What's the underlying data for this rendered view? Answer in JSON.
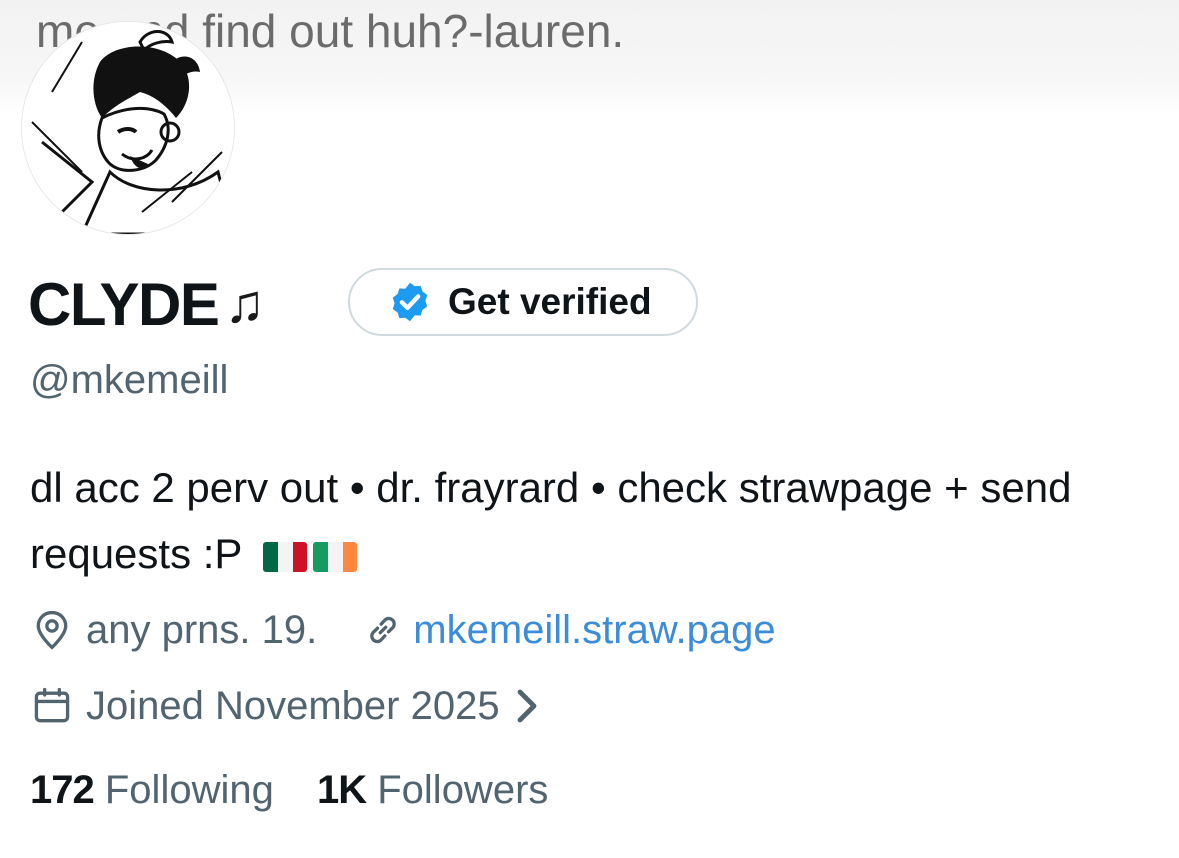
{
  "banner": {
    "text": "me and find out huh?-lauren."
  },
  "profile": {
    "display_name": "CLYDE",
    "name_emoji": "♫",
    "verify_button_label": "Get verified",
    "handle": "@mkemeill",
    "bio": "dl acc 2 perv out • dr. frayrard • check strawpage + send requests :P",
    "location": "any prns. 19.",
    "website": "mkemeill.straw.page",
    "joined": "Joined November 2025",
    "following_count": "172",
    "following_label": "Following",
    "followers_count": "1K",
    "followers_label": "Followers"
  },
  "colors": {
    "accent": "#1d9bf0",
    "link": "#3b8cd9",
    "secondary_text": "#536471",
    "primary_text": "#0f1419"
  },
  "icons": {
    "verified": "verified-badge-icon",
    "location": "location-pin-icon",
    "link": "link-icon",
    "calendar": "calendar-icon",
    "chevron": "chevron-right-icon",
    "flags": [
      "mexico-flag-icon",
      "ireland-flag-icon"
    ]
  }
}
